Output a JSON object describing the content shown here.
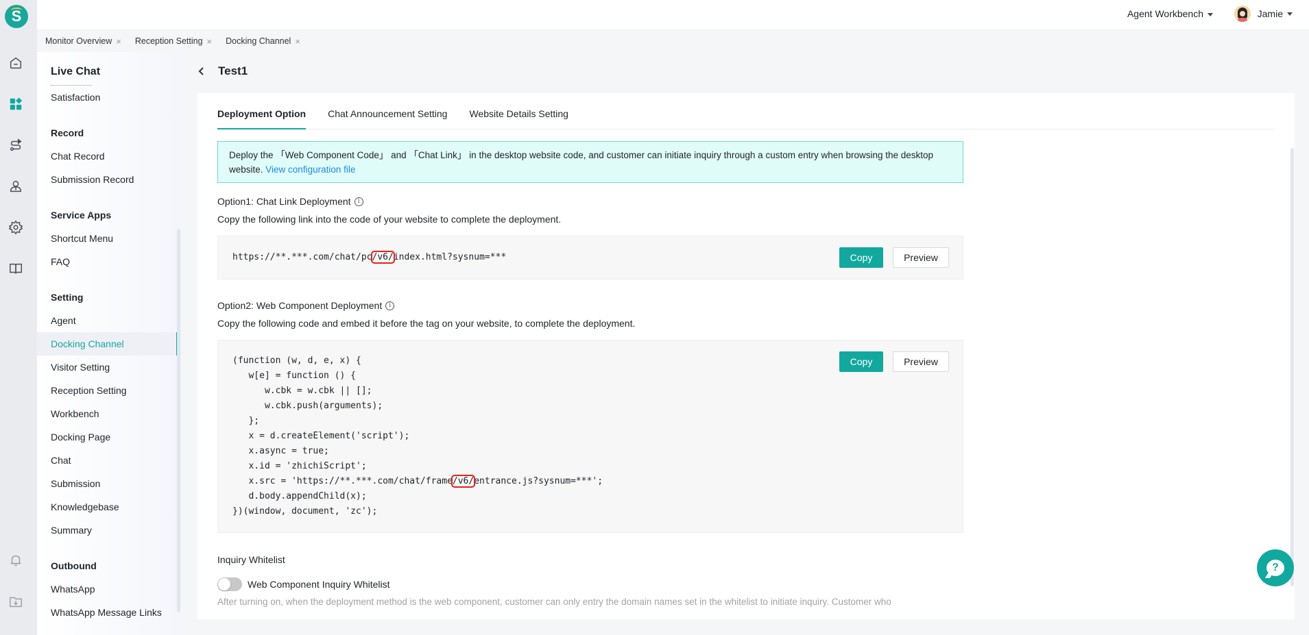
{
  "app": {
    "logo_letter": "S",
    "brand_color": "#13a89e"
  },
  "rail": {
    "icons": [
      "home-icon",
      "dashboard-icon",
      "route-icon",
      "agent-icon",
      "gear-icon",
      "book-icon",
      "bell-icon",
      "download-folder-icon"
    ],
    "active": "dashboard-icon"
  },
  "topbar": {
    "workbench_label": "Agent Workbench",
    "user_name": "Jamie"
  },
  "page_tabs": [
    {
      "label": "Monitor Overview",
      "close": "×"
    },
    {
      "label": "Reception Setting",
      "close": "×"
    },
    {
      "label": "Docking Channel",
      "close": "×"
    }
  ],
  "sidebar": {
    "title": "Live Chat",
    "items_top": [
      {
        "label": "Satisfaction"
      }
    ],
    "sections": [
      {
        "title": "Record",
        "items": [
          "Chat Record",
          "Submission Record"
        ]
      },
      {
        "title": "Service Apps",
        "items": [
          "Shortcut Menu",
          "FAQ"
        ]
      },
      {
        "title": "Setting",
        "items": [
          "Agent",
          "Docking Channel",
          "Visitor Setting",
          "Reception Setting",
          "Workbench",
          "Docking Page",
          "Chat",
          "Submission",
          "Knowledgebase",
          "Summary"
        ]
      },
      {
        "title": "Outbound",
        "items": [
          "WhatsApp",
          "WhatsApp Message Links"
        ]
      }
    ],
    "active_item": "Docking Channel"
  },
  "main": {
    "page_title": "Test1",
    "tabs": [
      {
        "label": "Deployment Option",
        "active": true
      },
      {
        "label": "Chat Announcement Setting",
        "active": false
      },
      {
        "label": "Website Details Setting",
        "active": false
      }
    ],
    "notice": {
      "text_1": "Deploy the 「Web Component Code」 and 「Chat Link」 in the desktop website code, and customer can initiate inquiry through a custom entry when browsing the desktop website. ",
      "link": "View configuration file"
    },
    "option1": {
      "title": "Option1: Chat Link Deployment",
      "desc": "Copy the following link into the code of your website to complete the deployment.",
      "code_pre": "https://**.***.com/chat/pc",
      "code_hl": "/v6/",
      "code_post": "index.html?sysnum=***",
      "copy_label": "Copy",
      "preview_label": "Preview"
    },
    "option2": {
      "title": "Option2: Web Component Deployment",
      "desc": "Copy the following code and embed it before the tag on your website, to complete the deployment.",
      "lines": [
        "(function (w, d, e, x) {",
        "   w[e] = function () {",
        "      w.cbk = w.cbk || [];",
        "      w.cbk.push(arguments);",
        "   };",
        "   x = d.createElement('script');",
        "   x.async = true;",
        "   x.id = 'zhichiScript';"
      ],
      "src_pre": "   x.src = 'https://**.***.com/chat/frame",
      "src_hl": "/v6/",
      "src_post": "entrance.js?sysnum=***';",
      "lines_after": [
        "   d.body.appendChild(x);",
        "})(window, document, 'zc');"
      ],
      "copy_label": "Copy",
      "preview_label": "Preview"
    },
    "whitelist": {
      "title": "Inquiry Whitelist",
      "toggle_label": "Web Component Inquiry Whitelist",
      "toggle_on": false,
      "desc": "After turning on, when the deployment method is the web component, customer can only entry the domain names set in the whitelist to initiate inquiry. Customer who"
    },
    "help_label": "?"
  }
}
